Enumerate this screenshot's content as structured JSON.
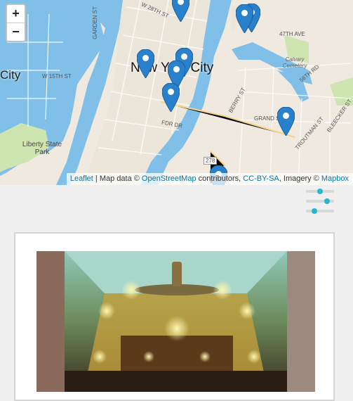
{
  "map": {
    "city_label": "New York City",
    "city_label_left": "City",
    "park_label": "Liberty State Park",
    "street_labels": [
      "W 28TH ST",
      "47TH AVE",
      "Calvary Cemetery",
      "56TH RD",
      "BERRY ST",
      "GRAND ST",
      "TROUTMAN ST",
      "BLEECKER ST",
      "FDR DR",
      "GARDEN ST",
      "W 15TH ST",
      "278"
    ],
    "zoom_in": "+",
    "zoom_out": "−",
    "attribution": {
      "leaflet": "Leaflet",
      "sep1": " | Map data © ",
      "osm": "OpenStreetMap",
      "sep2": " contributors, ",
      "license": "CC-BY-SA",
      "sep3": ", Imagery © ",
      "mapbox": "Mapbox"
    },
    "marker_count": 9
  },
  "filter_icon": "sliders-icon",
  "colors": {
    "water": "#7fbfe8",
    "marker": "#2a81cb",
    "filter": "#29b6d2"
  }
}
